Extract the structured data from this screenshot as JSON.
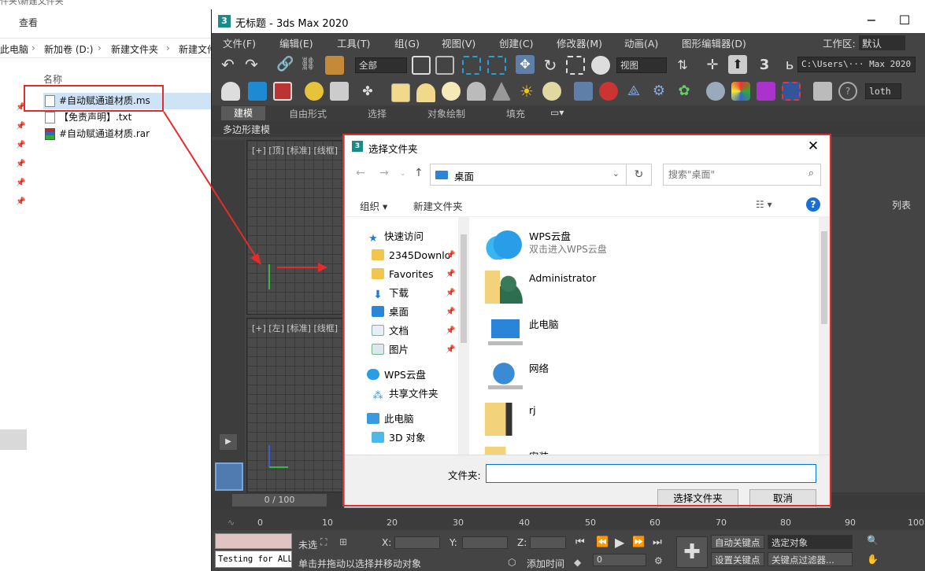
{
  "explorer": {
    "title_fragment": "件夹\\新建文件夹",
    "ribbon_view": "查看",
    "breadcrumb": [
      "此电脑",
      "新加卷 (D:)",
      "新建文件夹",
      "新建文件"
    ],
    "column_header": "名称",
    "files": [
      {
        "name": "#自动赋通道材质.ms",
        "type": "ms"
      },
      {
        "name": "【免责声明】.txt",
        "type": "txt"
      },
      {
        "name": "#自动赋通道材质.rar",
        "type": "rar"
      }
    ]
  },
  "max": {
    "title": "无标题 - 3ds Max 2020",
    "menu": [
      "文件(F)",
      "编辑(E)",
      "工具(T)",
      "组(G)",
      "视图(V)",
      "创建(C)",
      "修改器(M)",
      "动画(A)",
      "图形编辑器(D)"
    ],
    "workspace_label": "工作区:",
    "workspace_value": "默认",
    "selection_filter": "全部",
    "ref_coord": "视图",
    "path_field": "C:\\Users\\··· Max 2020",
    "loth_label": "loth",
    "ribbon_tabs": [
      "建模",
      "自由形式",
      "选择",
      "对象绘制",
      "填充"
    ],
    "subtab": "多边形建模",
    "viewport_top_label": "[+] [顶] [标准] [线框]",
    "viewport_left_label": "[+] [左] [标准] [线框]",
    "right_panel_label": "列表",
    "time_slider": "0 / 100",
    "ruler_ticks": [
      "0",
      "10",
      "20",
      "30",
      "40",
      "50",
      "60",
      "70",
      "80",
      "90",
      "100"
    ],
    "maxscript_text": "Testing for ALL",
    "status_unselected": "未选",
    "coord_labels": [
      "X:",
      "Y:",
      "Z:"
    ],
    "status_hint": "单击并拖动以选择并移动对象",
    "add_time_tag": "添加时间",
    "frame_value": "0",
    "auto_key": "自动关键点",
    "set_key": "设置关键点",
    "selected_object": "选定对象",
    "key_filter": "关键点过滤器..."
  },
  "dialog": {
    "title": "选择文件夹",
    "address": "桌面",
    "search_placeholder": "搜索\"桌面\"",
    "organize": "组织 ▾",
    "new_folder": "新建文件夹",
    "nav": [
      {
        "label": "快速访问",
        "icon": "star-icon",
        "pinned": false,
        "indent": 1
      },
      {
        "label": "2345Downlo",
        "icon": "folder-icon",
        "pinned": true,
        "indent": 2
      },
      {
        "label": "Favorites",
        "icon": "folder-icon",
        "pinned": true,
        "indent": 2
      },
      {
        "label": "下载",
        "icon": "download-icon",
        "pinned": true,
        "indent": 2
      },
      {
        "label": "桌面",
        "icon": "desktop-icon",
        "pinned": true,
        "indent": 2
      },
      {
        "label": "文档",
        "icon": "document-icon",
        "pinned": true,
        "indent": 2
      },
      {
        "label": "图片",
        "icon": "picture-icon",
        "pinned": true,
        "indent": 2
      },
      {
        "label": "WPS云盘",
        "icon": "cloud-icon",
        "pinned": false,
        "indent": 1
      },
      {
        "label": "共享文件夹",
        "icon": "share-icon",
        "pinned": false,
        "indent": 2
      },
      {
        "label": "此电脑",
        "icon": "computer-icon",
        "pinned": false,
        "indent": 1
      },
      {
        "label": "3D 对象",
        "icon": "3d-objects-icon",
        "pinned": false,
        "indent": 2
      }
    ],
    "items": [
      {
        "name": "WPS云盘",
        "sub": "双击进入WPS云盘",
        "icon": "cloud-icon"
      },
      {
        "name": "Administrator",
        "sub": "",
        "icon": "user-folder-icon"
      },
      {
        "name": "此电脑",
        "sub": "",
        "icon": "computer-icon"
      },
      {
        "name": "网络",
        "sub": "",
        "icon": "network-icon"
      },
      {
        "name": "rj",
        "sub": "",
        "icon": "folder-icon"
      },
      {
        "name": "安装",
        "sub": "",
        "icon": "folder-icon"
      }
    ],
    "folder_label": "文件夹:",
    "folder_value": "",
    "select_button": "选择文件夹",
    "cancel_button": "取消"
  },
  "colors": {
    "annotation_red": "#e62b2b",
    "max_dark": "#444444",
    "accent_blue": "#0078d7"
  }
}
